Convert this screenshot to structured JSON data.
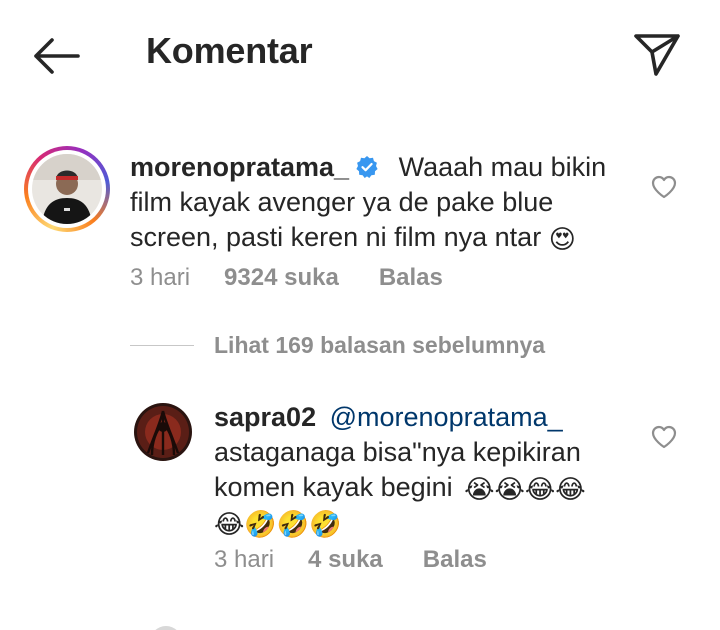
{
  "header": {
    "title": "Komentar",
    "back_icon": "arrow-left-icon",
    "send_icon": "paper-plane-icon"
  },
  "comment": {
    "username": "morenopratama_",
    "verified": true,
    "text_lines": [
      "Waaah mau bikin",
      "film kayak avenger ya de pake blue",
      "screen, pasti keren ni film nya ntar"
    ],
    "emoji": "😍",
    "time": "3 hari",
    "likes": "9324 suka",
    "reply_label": "Balas"
  },
  "view_replies": "Lihat 169 balasan sebelumnya",
  "reply": {
    "username": "sapra02",
    "mention": "@morenopratama_",
    "text_lines": [
      "astaganaga bisa\"nya kepikiran",
      "komen kayak begini"
    ],
    "emoji_line1": "😭😭😂😂",
    "emoji_line2": "😂🤣🤣🤣",
    "time": "3 hari",
    "likes": "4 suka",
    "reply_label": "Balas"
  },
  "colors": {
    "text": "#262626",
    "secondary": "#8e8e8e",
    "mention": "#00376b",
    "verified": "#3897f0"
  }
}
